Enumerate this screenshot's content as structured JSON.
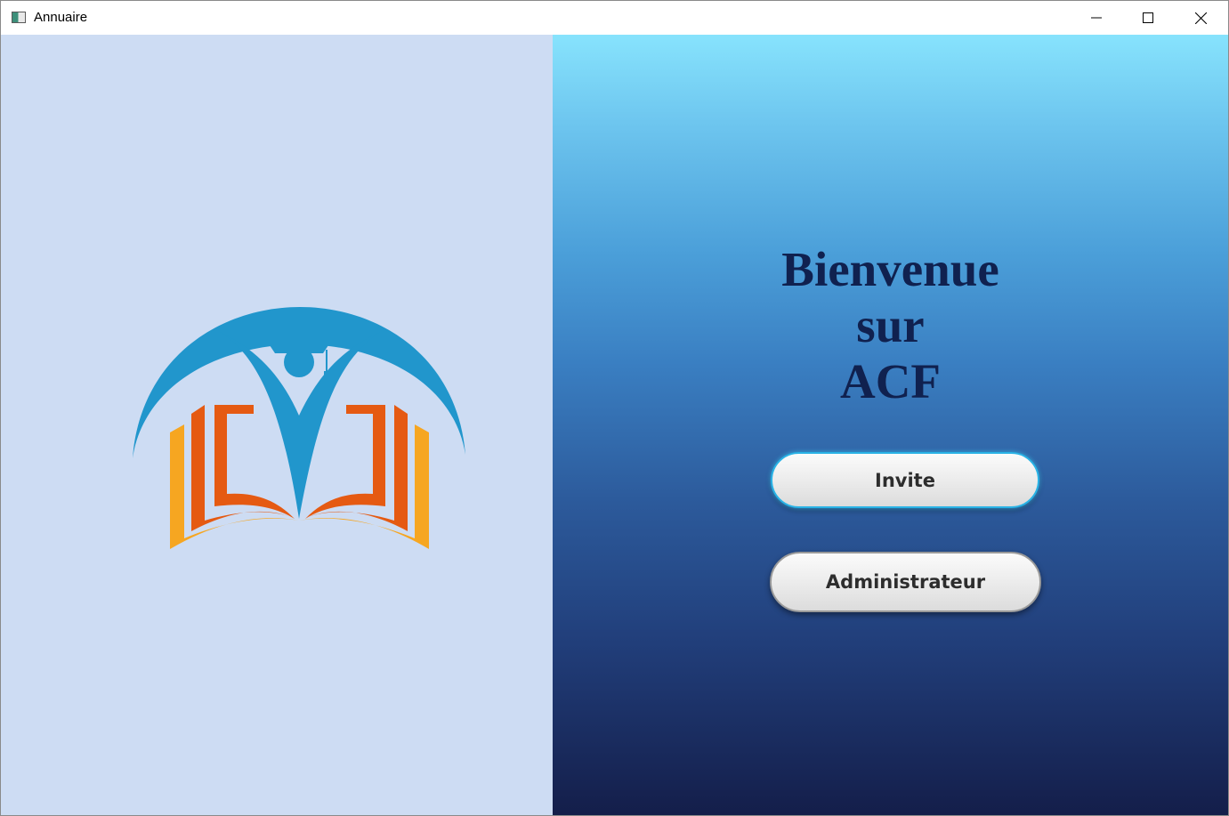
{
  "window": {
    "title": "Annuaire",
    "icon": "app-window-icon",
    "controls": {
      "minimize_icon": "minimize-icon",
      "maximize_icon": "maximize-icon",
      "close_icon": "close-icon"
    }
  },
  "left_panel": {
    "background": "#cddcf3",
    "logo": {
      "icon": "education-book-logo",
      "colors": {
        "arc": "#2196cc",
        "figure": "#2196cc",
        "inner_book": "#e55a12",
        "outer_book": "#f6a621"
      }
    }
  },
  "right_panel": {
    "welcome_lines": [
      "Bienvenue",
      "sur",
      "ACF"
    ],
    "welcome_color": "#10214f",
    "gradient_top": "#87e3fd",
    "gradient_bottom": "#141e4a",
    "buttons": {
      "invite_label": "Invite",
      "admin_label": "Administrateur"
    }
  }
}
